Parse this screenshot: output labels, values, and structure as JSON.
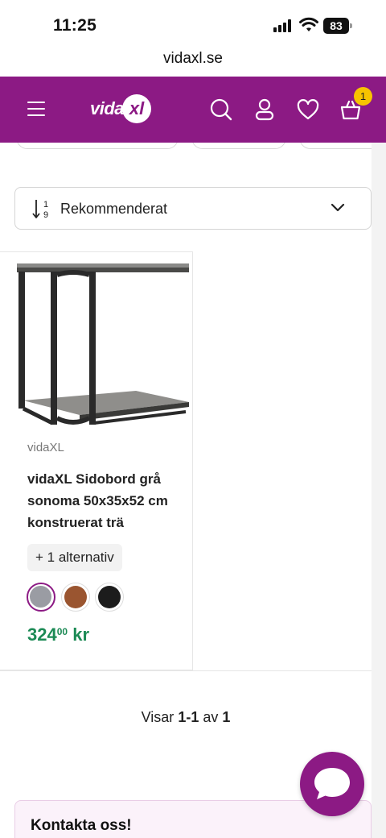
{
  "status_bar": {
    "time": "11:25",
    "battery": "83"
  },
  "browser": {
    "url": "vidaxl.se"
  },
  "header": {
    "logo_text": "vida",
    "logo_mark": "xl",
    "cart_count": "1",
    "icons": [
      "menu-icon",
      "search-icon",
      "account-icon",
      "heart-icon",
      "cart-icon"
    ]
  },
  "sort": {
    "label": "Rekommenderat",
    "icon": "sort-1-9-icon"
  },
  "products": [
    {
      "brand": "vidaXL",
      "title": "vidaXL Sidobord grå sonoma 50x35x52 cm konstruerat trä",
      "alternatives": "+ 1 alternativ",
      "swatches": [
        {
          "name": "grå",
          "color": "#9a9ca3",
          "selected": true
        },
        {
          "name": "brun",
          "color": "#9a5530",
          "selected": false
        },
        {
          "name": "svart",
          "color": "#1c1c1c",
          "selected": false
        }
      ],
      "price_main": "324",
      "price_cents": "00",
      "currency": "kr"
    }
  ],
  "pagination": {
    "prefix": "Visar",
    "range": "1-1",
    "of": "av",
    "total": "1"
  },
  "contact": {
    "title": "Kontakta oss!"
  },
  "colors": {
    "brand": "#8c1a84",
    "price": "#1c8a55",
    "badge": "#f7c400"
  }
}
